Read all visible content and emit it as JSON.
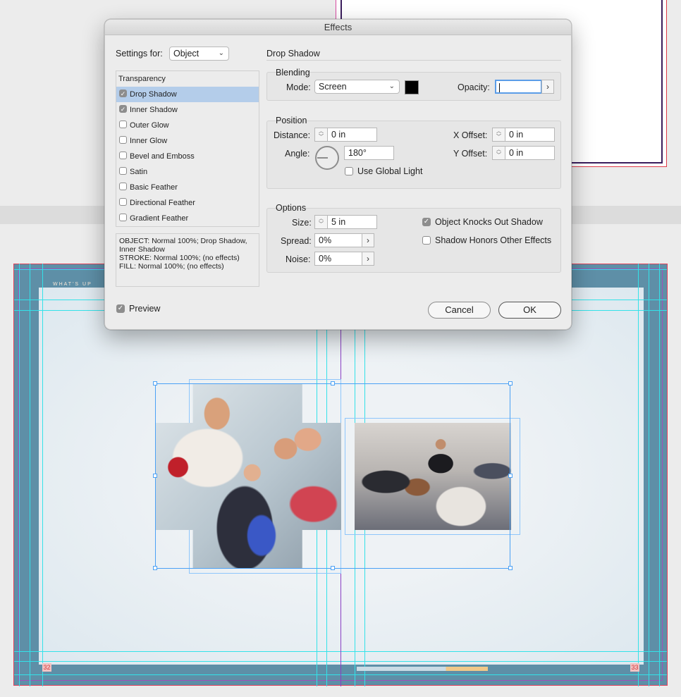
{
  "dialog": {
    "title": "Effects",
    "settings_for_label": "Settings for:",
    "settings_for_value": "Object",
    "section_title": "Drop Shadow",
    "effects_header": "Transparency",
    "effects": [
      {
        "label": "Drop Shadow",
        "checked": true,
        "selected": true
      },
      {
        "label": "Inner Shadow",
        "checked": true,
        "selected": false
      },
      {
        "label": "Outer Glow",
        "checked": false,
        "selected": false
      },
      {
        "label": "Inner Glow",
        "checked": false,
        "selected": false
      },
      {
        "label": "Bevel and Emboss",
        "checked": false,
        "selected": false
      },
      {
        "label": "Satin",
        "checked": false,
        "selected": false
      },
      {
        "label": "Basic Feather",
        "checked": false,
        "selected": false
      },
      {
        "label": "Directional Feather",
        "checked": false,
        "selected": false
      },
      {
        "label": "Gradient Feather",
        "checked": false,
        "selected": false
      }
    ],
    "summary": [
      "OBJECT: Normal 100%; Drop Shadow,",
      "Inner Shadow",
      "STROKE: Normal 100%; (no effects)",
      "FILL: Normal 100%; (no effects)"
    ],
    "blending": {
      "title": "Blending",
      "mode_label": "Mode:",
      "mode_value": "Screen",
      "swatch_color": "#000000",
      "opacity_label": "Opacity:",
      "opacity_value": ""
    },
    "position": {
      "title": "Position",
      "distance_label": "Distance:",
      "distance_value": "0 in",
      "angle_label": "Angle:",
      "angle_value": "180°",
      "global_light_label": "Use Global Light",
      "global_light_checked": false,
      "x_offset_label": "X Offset:",
      "x_offset_value": "0 in",
      "y_offset_label": "Y Offset:",
      "y_offset_value": "0 in"
    },
    "options": {
      "title": "Options",
      "size_label": "Size:",
      "size_value": "5 in",
      "spread_label": "Spread:",
      "spread_value": "0%",
      "noise_label": "Noise:",
      "noise_value": "0%",
      "knockout_label": "Object Knocks Out Shadow",
      "knockout_checked": true,
      "honors_label": "Shadow Honors Other Effects",
      "honors_checked": false
    },
    "preview_label": "Preview",
    "preview_checked": true,
    "cancel_label": "Cancel",
    "ok_label": "OK"
  },
  "document": {
    "running_head": "WHAT'S UP",
    "folio_left": "32",
    "folio_right": "33"
  },
  "colors": {
    "selection_blue": "#4ba1f5",
    "guide_cyan": "#33e2e9",
    "spread_teal": "#5e8fa7",
    "list_selection": "#b4cdea"
  }
}
